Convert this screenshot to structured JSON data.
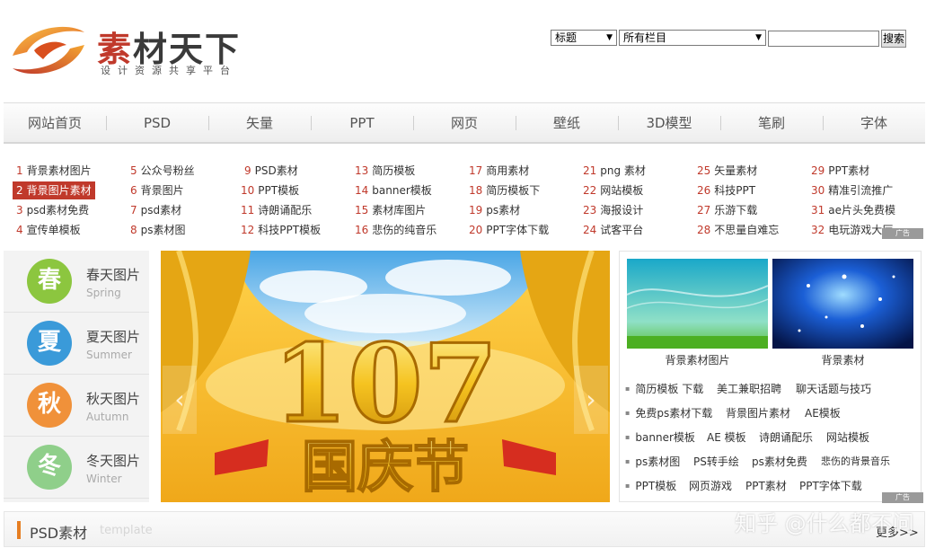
{
  "logo": {
    "title_first": "素",
    "title_rest": "材天下",
    "subtitle": "设计资源共享平台"
  },
  "search": {
    "field_select": "标题",
    "category_select": "所有栏目",
    "input_value": "",
    "button_label": "搜索"
  },
  "nav": [
    "网站首页",
    "PSD",
    "矢量",
    "PPT",
    "网页",
    "壁纸",
    "3D模型",
    "笔刷",
    "字体"
  ],
  "keywords": [
    [
      "1",
      "背景素材图片"
    ],
    [
      "2",
      "背景图片素材"
    ],
    [
      "3",
      "psd素材免费"
    ],
    [
      "4",
      "宣传单模板"
    ],
    [
      "5",
      "公众号粉丝"
    ],
    [
      "6",
      "背景图片"
    ],
    [
      "7",
      "psd素材"
    ],
    [
      "8",
      "ps素材图"
    ],
    [
      "9",
      "PSD素材"
    ],
    [
      "10",
      "PPT模板"
    ],
    [
      "11",
      "诗朗诵配乐"
    ],
    [
      "12",
      "科技PPT模板"
    ],
    [
      "13",
      "简历模板"
    ],
    [
      "14",
      "banner模板"
    ],
    [
      "15",
      "素材库图片"
    ],
    [
      "16",
      "悲伤的纯音乐"
    ],
    [
      "17",
      "商用素材"
    ],
    [
      "18",
      "简历模板下"
    ],
    [
      "19",
      "ps素材"
    ],
    [
      "20",
      "PPT字体下载"
    ],
    [
      "21",
      "png 素材"
    ],
    [
      "22",
      "网站模板"
    ],
    [
      "23",
      "海报设计"
    ],
    [
      "24",
      "试客平台"
    ],
    [
      "25",
      "矢量素材"
    ],
    [
      "26",
      "科技PPT"
    ],
    [
      "27",
      "乐游下载"
    ],
    [
      "28",
      "不思量自难忘"
    ],
    [
      "29",
      "PPT素材"
    ],
    [
      "30",
      "精准引流推广"
    ],
    [
      "31",
      "ae片头免费模"
    ],
    [
      "32",
      "电玩游戏大厅"
    ]
  ],
  "ad_label": "广告",
  "seasons": [
    {
      "char": "春",
      "name": "春天图片",
      "en": "Spring",
      "color": "#8cc63f"
    },
    {
      "char": "夏",
      "name": "夏天图片",
      "en": "Summer",
      "color": "#3a9ad9"
    },
    {
      "char": "秋",
      "name": "秋天图片",
      "en": "Autumn",
      "color": "#f0913a"
    },
    {
      "char": "冬",
      "name": "冬天图片",
      "en": "Winter",
      "color": "#8fcf8a"
    }
  ],
  "banner": {
    "number": "107",
    "text": "国庆节",
    "prev": "‹",
    "next": "›"
  },
  "right_panel": {
    "thumbs": [
      "背景素材图片",
      "背景素材"
    ],
    "link_rows": [
      [
        "简历模板 下载",
        "美工兼职招聘",
        "聊天话题与技巧"
      ],
      [
        "免费ps素材下载",
        "背景图片素材",
        "AE模板"
      ],
      [
        "banner模板",
        "AE 模板",
        "诗朗诵配乐",
        "网站模板"
      ],
      [
        "ps素材图",
        "PS转手绘",
        "ps素材免费",
        "悲伤的背景音乐"
      ],
      [
        "PPT模板",
        "网页游戏",
        "PPT素材",
        "PPT字体下载"
      ]
    ]
  },
  "psd_section": {
    "title": "PSD素材",
    "subtitle": "template",
    "more": "更多>>"
  },
  "watermark": "知乎 @什么都不问"
}
